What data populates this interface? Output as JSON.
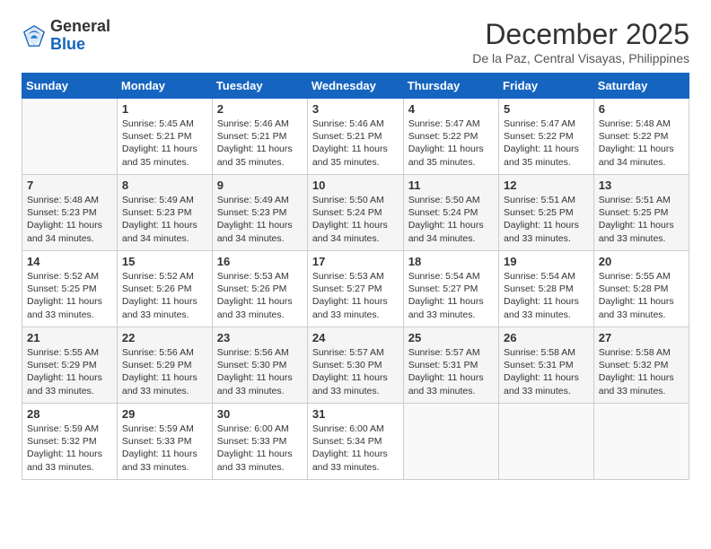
{
  "header": {
    "logo_general": "General",
    "logo_blue": "Blue",
    "month_title": "December 2025",
    "location": "De la Paz, Central Visayas, Philippines"
  },
  "columns": [
    "Sunday",
    "Monday",
    "Tuesday",
    "Wednesday",
    "Thursday",
    "Friday",
    "Saturday"
  ],
  "weeks": [
    [
      {
        "day": "",
        "sunrise": "",
        "sunset": "",
        "daylight": ""
      },
      {
        "day": "1",
        "sunrise": "5:45 AM",
        "sunset": "5:21 PM",
        "daylight": "11 hours and 35 minutes."
      },
      {
        "day": "2",
        "sunrise": "5:46 AM",
        "sunset": "5:21 PM",
        "daylight": "11 hours and 35 minutes."
      },
      {
        "day": "3",
        "sunrise": "5:46 AM",
        "sunset": "5:21 PM",
        "daylight": "11 hours and 35 minutes."
      },
      {
        "day": "4",
        "sunrise": "5:47 AM",
        "sunset": "5:22 PM",
        "daylight": "11 hours and 35 minutes."
      },
      {
        "day": "5",
        "sunrise": "5:47 AM",
        "sunset": "5:22 PM",
        "daylight": "11 hours and 35 minutes."
      },
      {
        "day": "6",
        "sunrise": "5:48 AM",
        "sunset": "5:22 PM",
        "daylight": "11 hours and 34 minutes."
      }
    ],
    [
      {
        "day": "7",
        "sunrise": "5:48 AM",
        "sunset": "5:23 PM",
        "daylight": "11 hours and 34 minutes."
      },
      {
        "day": "8",
        "sunrise": "5:49 AM",
        "sunset": "5:23 PM",
        "daylight": "11 hours and 34 minutes."
      },
      {
        "day": "9",
        "sunrise": "5:49 AM",
        "sunset": "5:23 PM",
        "daylight": "11 hours and 34 minutes."
      },
      {
        "day": "10",
        "sunrise": "5:50 AM",
        "sunset": "5:24 PM",
        "daylight": "11 hours and 34 minutes."
      },
      {
        "day": "11",
        "sunrise": "5:50 AM",
        "sunset": "5:24 PM",
        "daylight": "11 hours and 34 minutes."
      },
      {
        "day": "12",
        "sunrise": "5:51 AM",
        "sunset": "5:25 PM",
        "daylight": "11 hours and 33 minutes."
      },
      {
        "day": "13",
        "sunrise": "5:51 AM",
        "sunset": "5:25 PM",
        "daylight": "11 hours and 33 minutes."
      }
    ],
    [
      {
        "day": "14",
        "sunrise": "5:52 AM",
        "sunset": "5:25 PM",
        "daylight": "11 hours and 33 minutes."
      },
      {
        "day": "15",
        "sunrise": "5:52 AM",
        "sunset": "5:26 PM",
        "daylight": "11 hours and 33 minutes."
      },
      {
        "day": "16",
        "sunrise": "5:53 AM",
        "sunset": "5:26 PM",
        "daylight": "11 hours and 33 minutes."
      },
      {
        "day": "17",
        "sunrise": "5:53 AM",
        "sunset": "5:27 PM",
        "daylight": "11 hours and 33 minutes."
      },
      {
        "day": "18",
        "sunrise": "5:54 AM",
        "sunset": "5:27 PM",
        "daylight": "11 hours and 33 minutes."
      },
      {
        "day": "19",
        "sunrise": "5:54 AM",
        "sunset": "5:28 PM",
        "daylight": "11 hours and 33 minutes."
      },
      {
        "day": "20",
        "sunrise": "5:55 AM",
        "sunset": "5:28 PM",
        "daylight": "11 hours and 33 minutes."
      }
    ],
    [
      {
        "day": "21",
        "sunrise": "5:55 AM",
        "sunset": "5:29 PM",
        "daylight": "11 hours and 33 minutes."
      },
      {
        "day": "22",
        "sunrise": "5:56 AM",
        "sunset": "5:29 PM",
        "daylight": "11 hours and 33 minutes."
      },
      {
        "day": "23",
        "sunrise": "5:56 AM",
        "sunset": "5:30 PM",
        "daylight": "11 hours and 33 minutes."
      },
      {
        "day": "24",
        "sunrise": "5:57 AM",
        "sunset": "5:30 PM",
        "daylight": "11 hours and 33 minutes."
      },
      {
        "day": "25",
        "sunrise": "5:57 AM",
        "sunset": "5:31 PM",
        "daylight": "11 hours and 33 minutes."
      },
      {
        "day": "26",
        "sunrise": "5:58 AM",
        "sunset": "5:31 PM",
        "daylight": "11 hours and 33 minutes."
      },
      {
        "day": "27",
        "sunrise": "5:58 AM",
        "sunset": "5:32 PM",
        "daylight": "11 hours and 33 minutes."
      }
    ],
    [
      {
        "day": "28",
        "sunrise": "5:59 AM",
        "sunset": "5:32 PM",
        "daylight": "11 hours and 33 minutes."
      },
      {
        "day": "29",
        "sunrise": "5:59 AM",
        "sunset": "5:33 PM",
        "daylight": "11 hours and 33 minutes."
      },
      {
        "day": "30",
        "sunrise": "6:00 AM",
        "sunset": "5:33 PM",
        "daylight": "11 hours and 33 minutes."
      },
      {
        "day": "31",
        "sunrise": "6:00 AM",
        "sunset": "5:34 PM",
        "daylight": "11 hours and 33 minutes."
      },
      {
        "day": "",
        "sunrise": "",
        "sunset": "",
        "daylight": ""
      },
      {
        "day": "",
        "sunrise": "",
        "sunset": "",
        "daylight": ""
      },
      {
        "day": "",
        "sunrise": "",
        "sunset": "",
        "daylight": ""
      }
    ]
  ]
}
